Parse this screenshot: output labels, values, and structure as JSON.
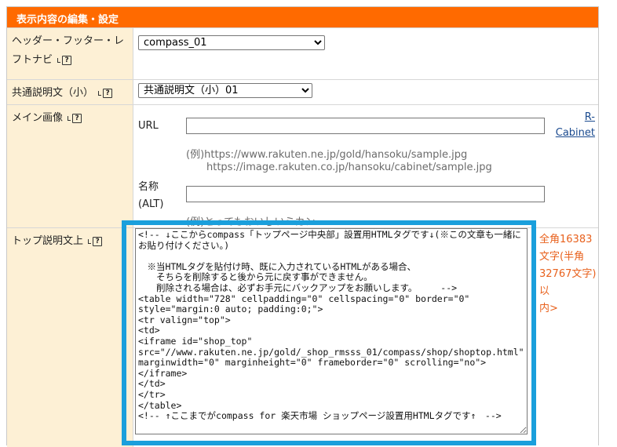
{
  "header": {
    "title": "表示内容の編集・設定"
  },
  "rows": {
    "header_footer": {
      "label_line1": "ヘッダー・フッター・レ",
      "label_line2": "フトナビ",
      "select_value": "compass_01"
    },
    "common_desc": {
      "label": "共通説明文（小）",
      "select_value": "共通説明文（小）01"
    },
    "main_image": {
      "label": "メイン画像",
      "url_label": "URL",
      "url_value": "",
      "example1": "(例)https://www.rakuten.ne.jp/gold/hansoku/sample.jpg",
      "example2": "https://image.rakuten.co.jp/hansoku/cabinet/sample.jpg",
      "rcabinet_line1": "R-",
      "rcabinet_line2": "Cabinet",
      "alt_label_line1": "名称",
      "alt_label_line2": "(ALT)",
      "alt_value": "",
      "alt_example": "(例)とってもおいしいミカン"
    },
    "top_desc": {
      "label": "トップ説明文上",
      "limit_line1": "全角16383",
      "limit_line2": "文字(半角",
      "limit_line3": "32767文字)以",
      "limit_line4": "内>",
      "textarea_value": "<!-- ↓ここからcompass「トップページ中央部」設置用HTMLタグです↓(※この文章も一緒にお貼り付けください。)\n\n　※当HTMLタグを貼付け時、既に入力されているHTMLがある場合、\n　　そちらを削除すると後から元に戻す事ができません。\n　　削除される場合は、必ずお手元にバックアップをお願いします。 　　-->\n<table width=\"728\" cellpadding=\"0\" cellspacing=\"0\" border=\"0\" style=\"margin:0 auto; padding:0;\">\n<tr valign=\"top\">\n<td>\n<iframe id=\"shop_top\" src=\"//www.rakuten.ne.jp/gold/_shop_rmsss_01/compass/shop/shoptop.html\" marginwidth=\"0\" marginheight=\"0\" frameborder=\"0\" scrolling=\"no\">\n</iframe>\n</td>\n</tr>\n</table>\n<!-- ↑ここまでがcompass for 楽天市場 ショップページ設置用HTMLタグです↑　-->"
    }
  },
  "colors": {
    "header_bg": "#ff6a00",
    "label_bg": "#fdf0d5",
    "highlight": "#1a9fdc",
    "limit_text": "#e8611d"
  }
}
